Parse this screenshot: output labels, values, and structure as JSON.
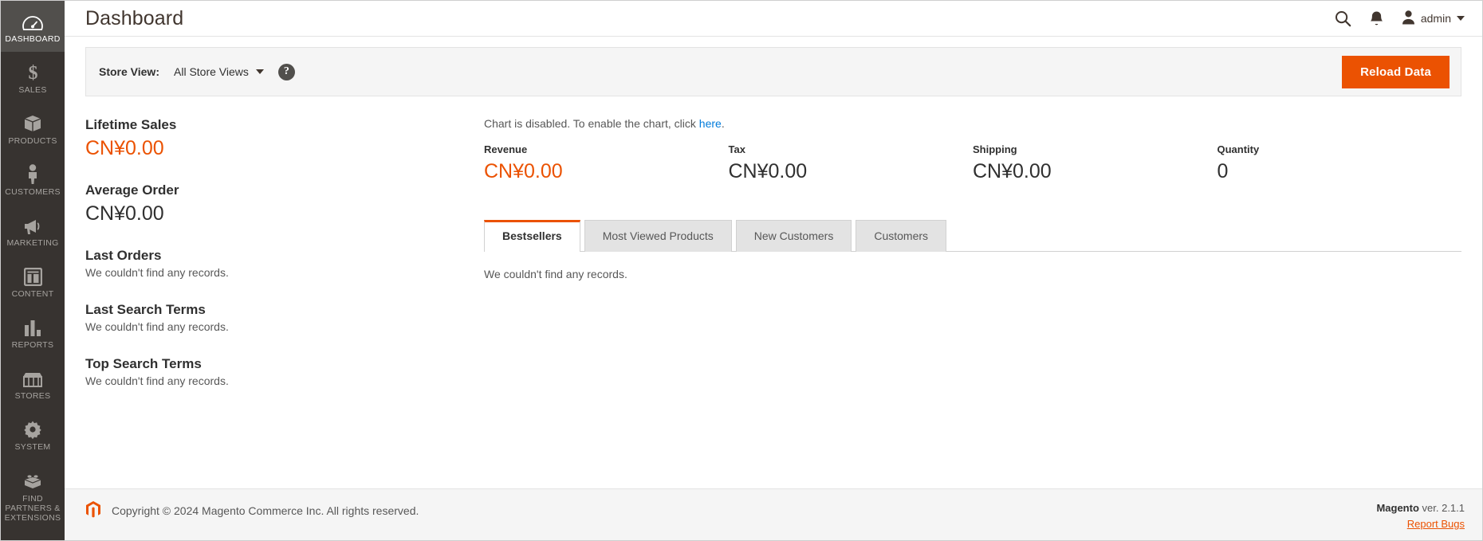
{
  "sidebar": {
    "items": [
      {
        "label": "DASHBOARD",
        "icon": "dashboard-gauge-icon",
        "active": true
      },
      {
        "label": "SALES",
        "icon": "dollar-icon",
        "active": false
      },
      {
        "label": "PRODUCTS",
        "icon": "box-icon",
        "active": false
      },
      {
        "label": "CUSTOMERS",
        "icon": "person-icon",
        "active": false
      },
      {
        "label": "MARKETING",
        "icon": "megaphone-icon",
        "active": false
      },
      {
        "label": "CONTENT",
        "icon": "layout-icon",
        "active": false
      },
      {
        "label": "REPORTS",
        "icon": "bar-chart-icon",
        "active": false
      },
      {
        "label": "STORES",
        "icon": "storefront-icon",
        "active": false
      },
      {
        "label": "SYSTEM",
        "icon": "gear-icon",
        "active": false
      }
    ],
    "partners": {
      "label": "FIND PARTNERS & EXTENSIONS",
      "icon": "lego-brick-icon"
    }
  },
  "header": {
    "title": "Dashboard",
    "search_icon": "search-icon",
    "notifications_icon": "bell-icon",
    "user_icon": "person-icon",
    "user_name": "admin"
  },
  "storebar": {
    "label": "Store View:",
    "selected": "All Store Views",
    "help_icon": "question-mark-icon",
    "reload_label": "Reload Data"
  },
  "stats": {
    "lifetime": {
      "title": "Lifetime Sales",
      "value": "CN¥0.00"
    },
    "average": {
      "title": "Average Order",
      "value": "CN¥0.00"
    }
  },
  "lists": [
    {
      "title": "Last Orders",
      "empty": "We couldn't find any records."
    },
    {
      "title": "Last Search Terms",
      "empty": "We couldn't find any records."
    },
    {
      "title": "Top Search Terms",
      "empty": "We couldn't find any records."
    }
  ],
  "chart": {
    "message_prefix": "Chart is disabled. To enable the chart, click ",
    "link_text": "here",
    "message_suffix": "."
  },
  "kpis": [
    {
      "label": "Revenue",
      "value": "CN¥0.00",
      "accent": true
    },
    {
      "label": "Tax",
      "value": "CN¥0.00",
      "accent": false
    },
    {
      "label": "Shipping",
      "value": "CN¥0.00",
      "accent": false
    },
    {
      "label": "Quantity",
      "value": "0",
      "accent": false
    }
  ],
  "tabs": [
    {
      "label": "Bestsellers",
      "active": true
    },
    {
      "label": "Most Viewed Products",
      "active": false
    },
    {
      "label": "New Customers",
      "active": false
    },
    {
      "label": "Customers",
      "active": false
    }
  ],
  "tab_panel": {
    "empty": "We couldn't find any records."
  },
  "footer": {
    "copyright": "Copyright © 2024 Magento Commerce Inc. All rights reserved.",
    "brand": "Magento",
    "version": " ver. 2.1.1",
    "report_bugs": "Report Bugs"
  },
  "colors": {
    "accent": "#eb5202",
    "link": "#007bdb",
    "sidebar": "#373330"
  }
}
